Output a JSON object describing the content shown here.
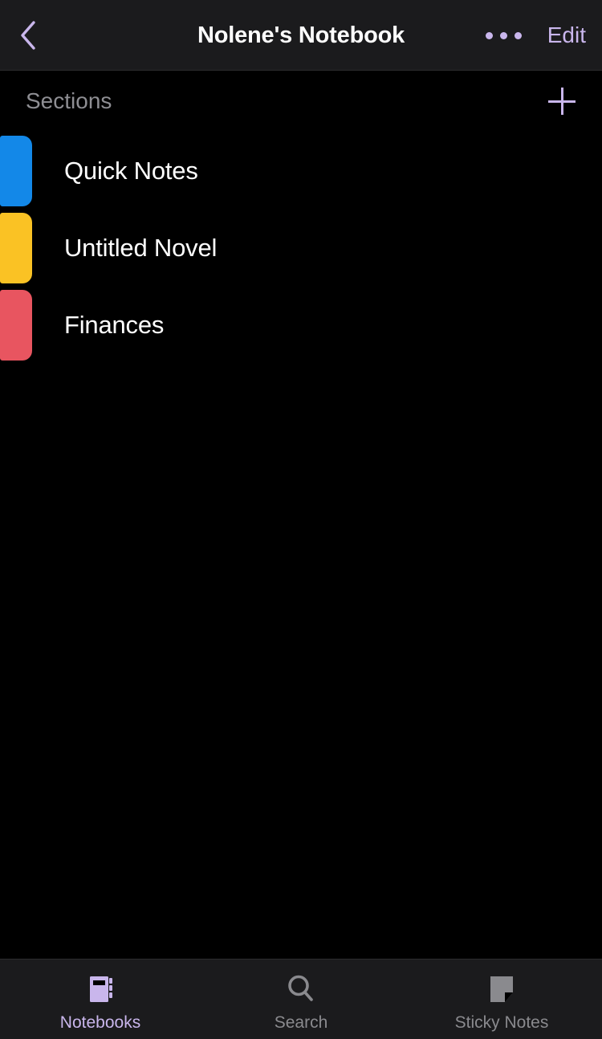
{
  "navbar": {
    "back_icon": "chevron-left-icon",
    "title": "Nolene's Notebook",
    "more_icon": "more-horizontal-icon",
    "edit_label": "Edit",
    "accent_color": "#c9b6ec",
    "background": "#1b1b1d"
  },
  "sections_header": {
    "title": "Sections",
    "add_icon": "plus-icon",
    "title_color": "#8e8e93"
  },
  "sections": [
    {
      "label": "Quick Notes",
      "color": "#1388e8"
    },
    {
      "label": "Untitled Novel",
      "color": "#fac224"
    },
    {
      "label": "Finances",
      "color": "#e85560"
    }
  ],
  "tabbar": {
    "items": [
      {
        "label": "Notebooks",
        "icon": "notebook-icon",
        "active": true
      },
      {
        "label": "Search",
        "icon": "search-icon",
        "active": false
      },
      {
        "label": "Sticky Notes",
        "icon": "sticky-note-icon",
        "active": false
      }
    ],
    "active_color": "#c9b6ec",
    "inactive_color": "#8a8a8e",
    "background": "#1b1b1d"
  },
  "theme": {
    "page_background": "#000000",
    "text_primary": "#ffffff"
  }
}
